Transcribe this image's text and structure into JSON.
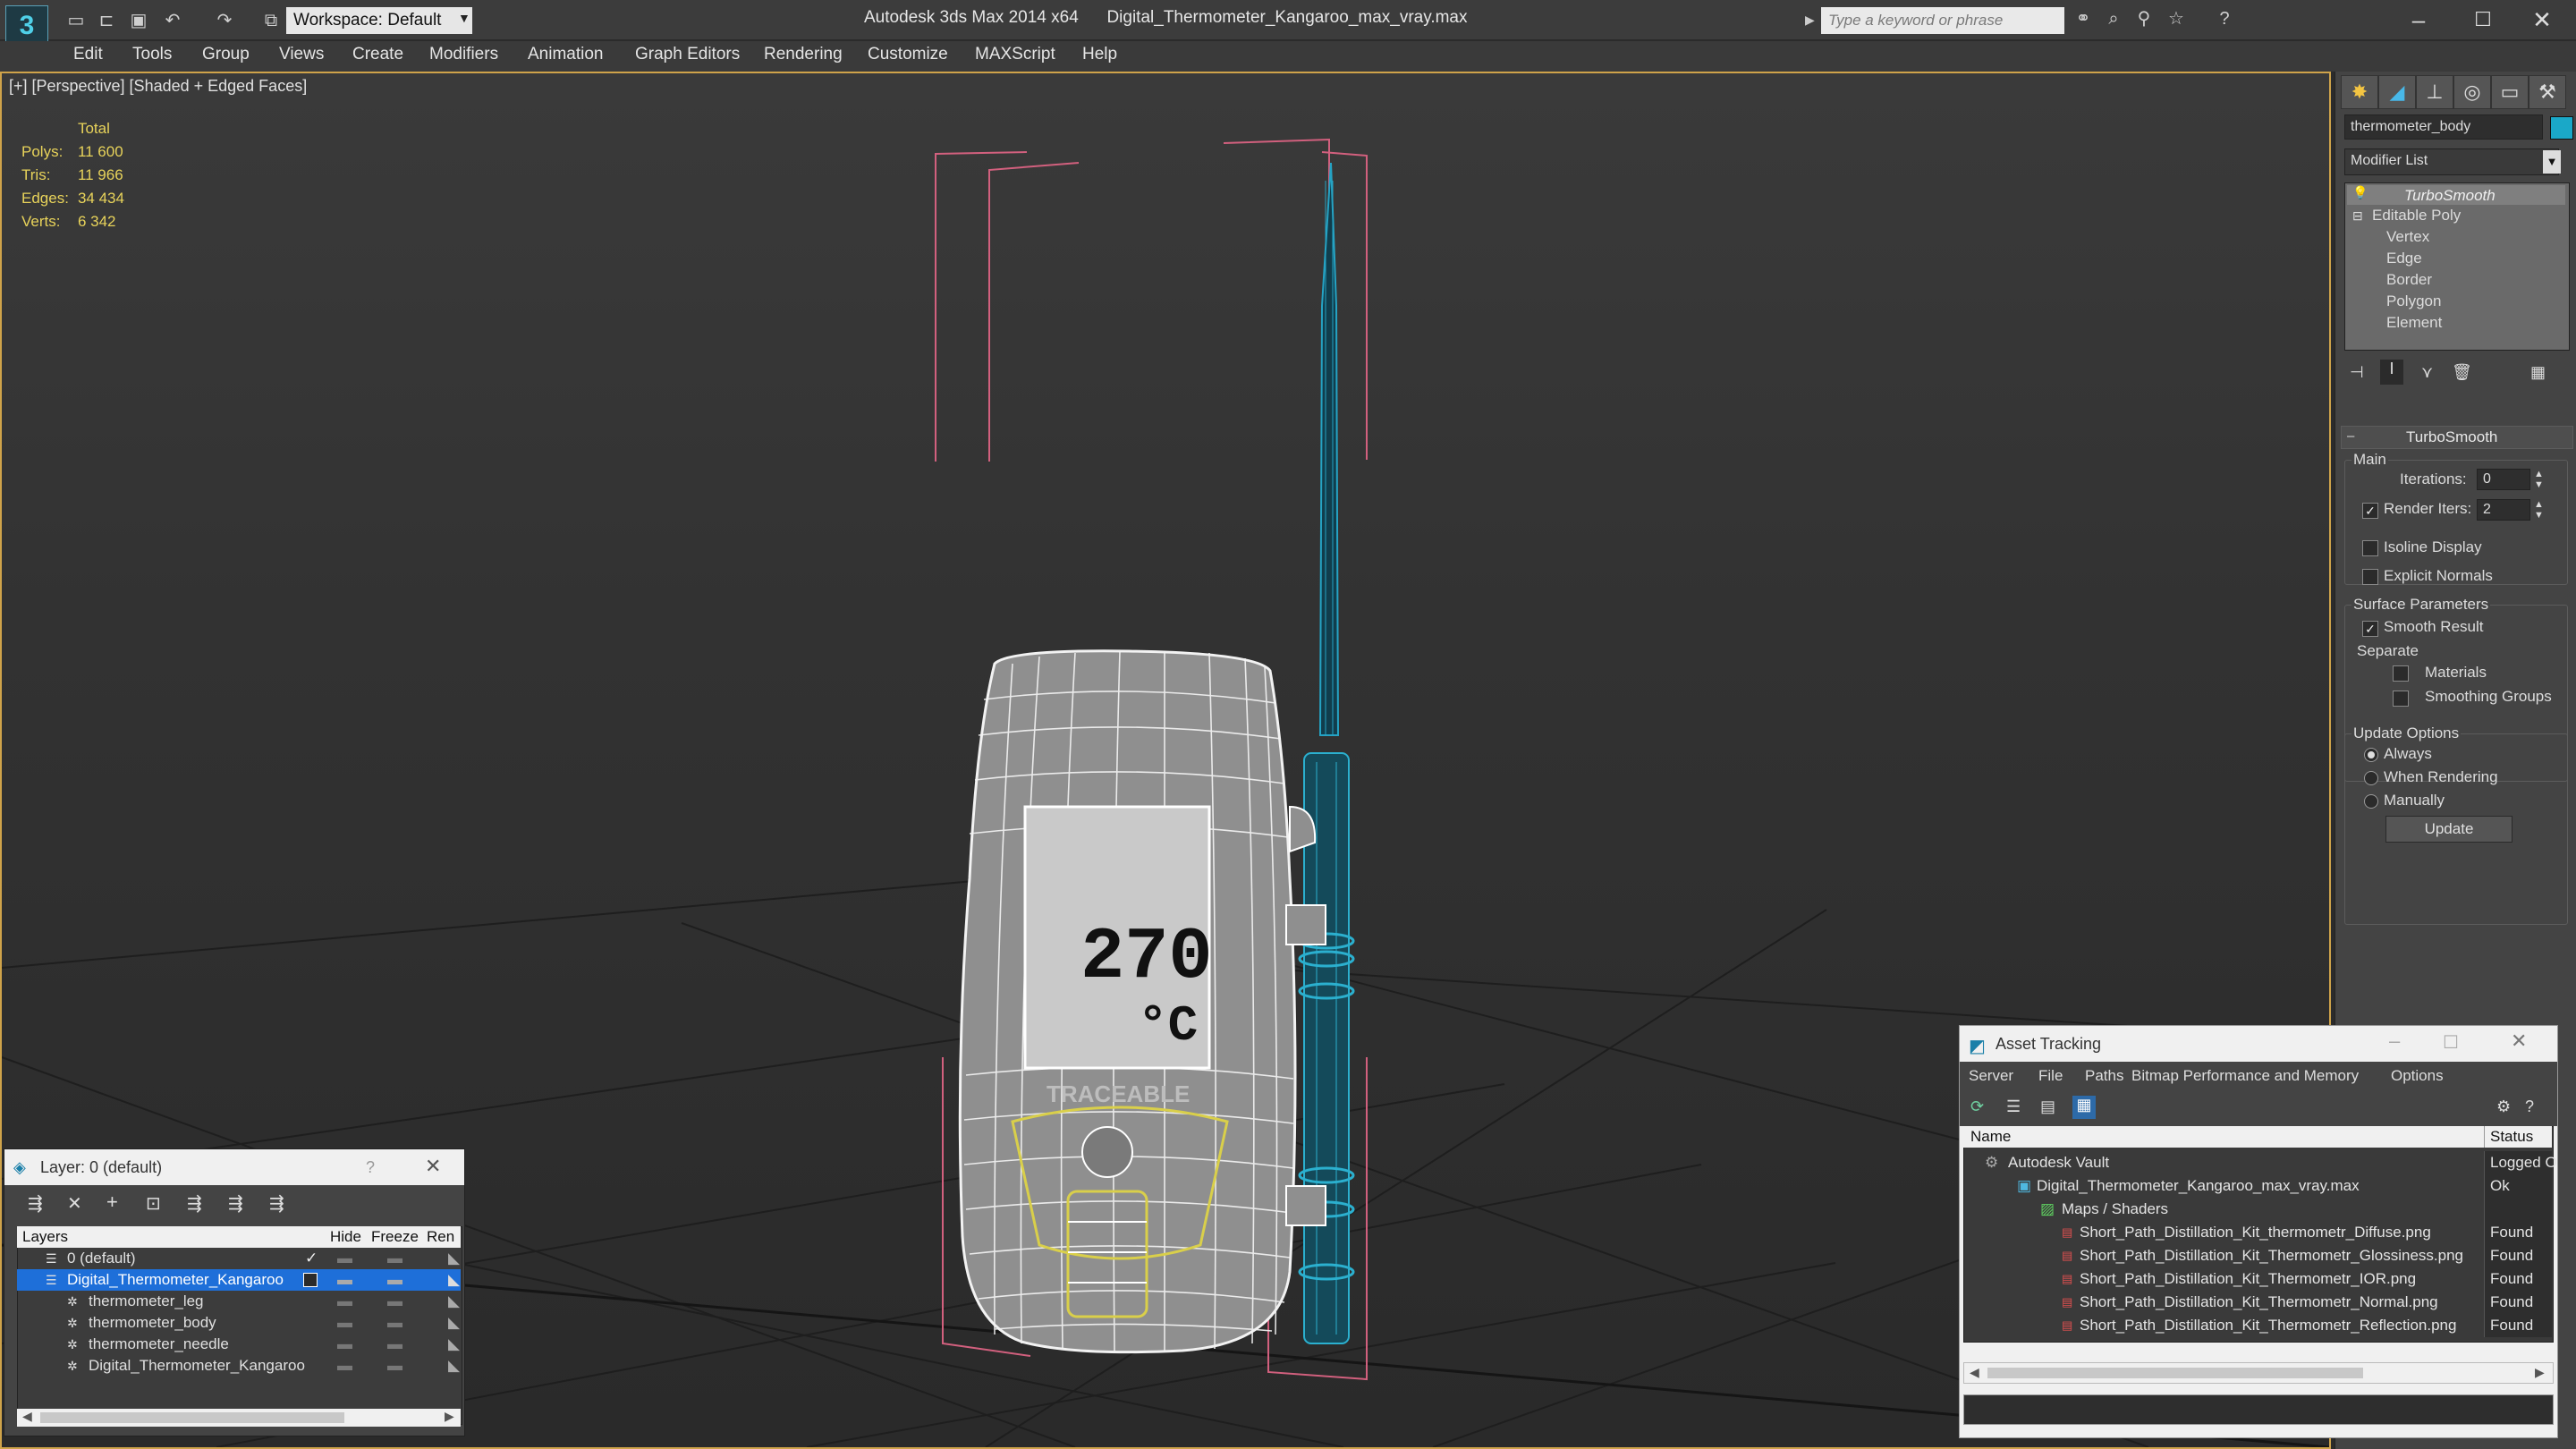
{
  "titlebar": {
    "app": "Autodesk 3ds Max 2014 x64",
    "file": "Digital_Thermometer_Kangaroo_max_vray.max",
    "workspace": "Workspace: Default",
    "search_placeholder": "Type a keyword or phrase"
  },
  "menu": [
    "Edit",
    "Tools",
    "Group",
    "Views",
    "Create",
    "Modifiers",
    "Animation",
    "Graph Editors",
    "Rendering",
    "Customize",
    "MAXScript",
    "Help"
  ],
  "viewport": {
    "label": "[+] [Perspective] [Shaded + Edged Faces]",
    "stats": {
      "header": "Total",
      "rows": [
        {
          "label": "Polys:",
          "value": "11 600"
        },
        {
          "label": "Tris:",
          "value": "11 966"
        },
        {
          "label": "Edges:",
          "value": "34 434"
        },
        {
          "label": "Verts:",
          "value": "6 342"
        }
      ]
    },
    "display_text": "270",
    "display_unit": "°C",
    "brand_text": "TRACEABLE"
  },
  "command_panel": {
    "object_name": "thermometer_body",
    "object_color": "#1aa8c8",
    "modifier_list": "Modifier List",
    "stack": [
      {
        "label": "TurboSmooth",
        "level": 0
      },
      {
        "label": "Editable Poly",
        "level": 0
      },
      {
        "label": "Vertex",
        "level": 1
      },
      {
        "label": "Edge",
        "level": 1
      },
      {
        "label": "Border",
        "level": 1
      },
      {
        "label": "Polygon",
        "level": 1
      },
      {
        "label": "Element",
        "level": 1
      }
    ],
    "rollout_title": "TurboSmooth",
    "main_group": "Main",
    "iterations_label": "Iterations:",
    "iterations_value": "0",
    "render_iters_label": "Render Iters:",
    "render_iters_value": "2",
    "isoline_label": "Isoline Display",
    "explicit_normals_label": "Explicit Normals",
    "surface_group": "Surface Parameters",
    "smooth_result_label": "Smooth Result",
    "separate_label": "Separate",
    "materials_label": "Materials",
    "smoothing_groups_label": "Smoothing Groups",
    "update_group": "Update Options",
    "always_label": "Always",
    "when_rendering_label": "When Rendering",
    "manually_label": "Manually",
    "update_button": "Update"
  },
  "layers": {
    "title": "Layer: 0 (default)",
    "help": "?",
    "columns": [
      "Layers",
      "Hide",
      "Freeze",
      "Ren"
    ],
    "rows": [
      {
        "name": "0 (default)",
        "level": 0,
        "selected": false
      },
      {
        "name": "Digital_Thermometer_Kangaroo",
        "level": 0,
        "selected": true
      },
      {
        "name": "thermometer_leg",
        "level": 1,
        "selected": false
      },
      {
        "name": "thermometer_body",
        "level": 1,
        "selected": false
      },
      {
        "name": "thermometer_needle",
        "level": 1,
        "selected": false
      },
      {
        "name": "Digital_Thermometer_Kangaroo",
        "level": 1,
        "selected": false
      }
    ]
  },
  "asset_tracking": {
    "title": "Asset Tracking",
    "menu": [
      "Server",
      "File",
      "Paths",
      "Bitmap Performance and Memory",
      "Options"
    ],
    "columns": [
      "Name",
      "Status"
    ],
    "rows": [
      {
        "name": "Autodesk Vault",
        "status": "Logged O",
        "level": 0
      },
      {
        "name": "Digital_Thermometer_Kangaroo_max_vray.max",
        "status": "Ok",
        "level": 1
      },
      {
        "name": "Maps / Shaders",
        "status": "",
        "level": 2
      },
      {
        "name": "Short_Path_Distillation_Kit_thermometr_Diffuse.png",
        "status": "Found",
        "level": 3
      },
      {
        "name": "Short_Path_Distillation_Kit_Thermometr_Glossiness.png",
        "status": "Found",
        "level": 3
      },
      {
        "name": "Short_Path_Distillation_Kit_Thermometr_IOR.png",
        "status": "Found",
        "level": 3
      },
      {
        "name": "Short_Path_Distillation_Kit_Thermometr_Normal.png",
        "status": "Found",
        "level": 3
      },
      {
        "name": "Short_Path_Distillation_Kit_Thermometr_Reflection.png",
        "status": "Found",
        "level": 3
      }
    ]
  }
}
